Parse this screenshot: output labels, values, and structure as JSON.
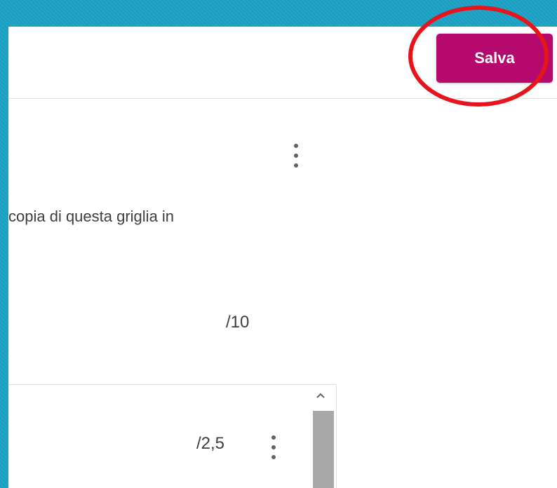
{
  "header": {
    "save_label": "Salva"
  },
  "rubric": {
    "description": "copia di questa griglia in",
    "total_score": "/10",
    "criterion": {
      "score": "/2,5"
    }
  },
  "icons": {
    "more_options": "more-vertical-icon",
    "scroll_up": "chevron-up-icon"
  },
  "colors": {
    "save_button": "#b5096e",
    "annotation": "#e8141b",
    "background": "#21a6c8"
  }
}
